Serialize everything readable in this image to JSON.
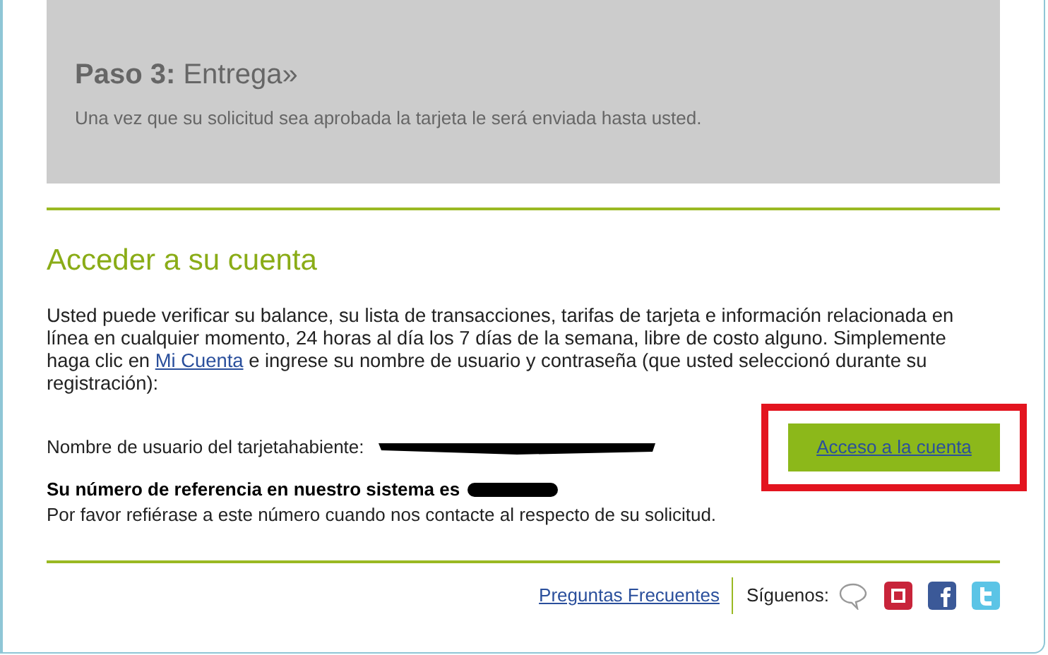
{
  "step": {
    "label": "Paso 3:",
    "title": "Entrega»",
    "text": "Una vez que su solicitud sea aprobada la tarjeta le será enviada hasta usted."
  },
  "account": {
    "heading": "Acceder a su cuenta",
    "paragraph_before": "Usted puede verificar su balance, su lista de transacciones, tarifas de tarjeta e información relacionada en línea en cualquier momento, 24 horas al día los 7 días de la semana, libre de costo alguno. Simplemente haga clic en",
    "paragraph_link": "Mi Cuenta",
    "paragraph_after": "e ingrese su nombre de usuario y contraseña (que usted seleccionó durante su registración):",
    "username_label": "Nombre de usuario del tarjetahabiente:",
    "access_button": "Acceso a la cuenta",
    "reference_label": "Su número de referencia en nuestro sistema es",
    "reference_note": "Por favor refiérase a este número cuando nos contacte al respecto de su solicitud."
  },
  "footer": {
    "faq_link": "Preguntas Frecuentes",
    "follow_label": "Síguenos:",
    "social": [
      {
        "kind": "chat"
      },
      {
        "kind": "red"
      },
      {
        "kind": "facebook"
      },
      {
        "kind": "twitter"
      }
    ]
  }
}
